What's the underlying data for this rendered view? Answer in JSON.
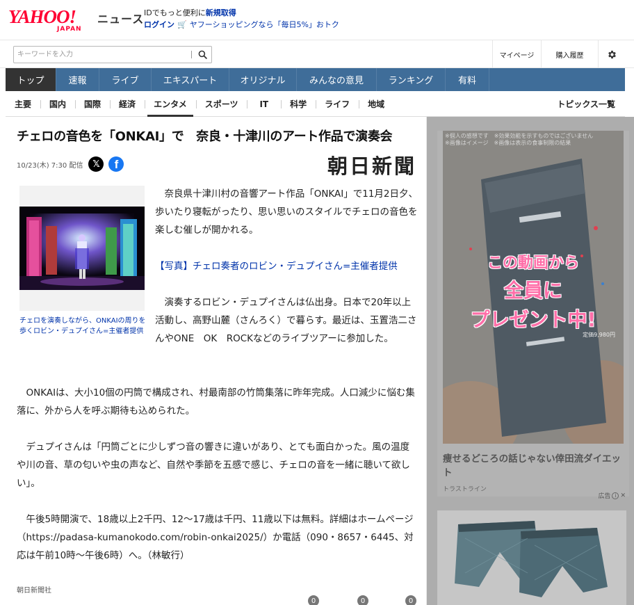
{
  "header": {
    "logo_yahoo": "YAHOO!",
    "logo_japan": "JAPAN",
    "logo_news": "ニュース",
    "promo_text": "IDでもっと便利に",
    "promo_register": "新規取得",
    "login": "ログイン",
    "shopping_promo": "ヤフーショッピングなら「毎日5%」おトク"
  },
  "search": {
    "placeholder": "キーワードを入力",
    "mypage": "マイページ",
    "purchase_history": "購入履歴"
  },
  "main_nav": [
    {
      "label": "トップ"
    },
    {
      "label": "速報"
    },
    {
      "label": "ライブ"
    },
    {
      "label": "エキスパート"
    },
    {
      "label": "オリジナル"
    },
    {
      "label": "みんなの意見"
    },
    {
      "label": "ランキング"
    },
    {
      "label": "有料"
    }
  ],
  "sub_nav": [
    {
      "label": "主要"
    },
    {
      "label": "国内"
    },
    {
      "label": "国際"
    },
    {
      "label": "経済"
    },
    {
      "label": "エンタメ"
    },
    {
      "label": "スポーツ"
    },
    {
      "label": "IT"
    },
    {
      "label": "科学"
    },
    {
      "label": "ライフ"
    },
    {
      "label": "地域"
    }
  ],
  "topics_all": "トピックス一覧",
  "article": {
    "title": "チェロの音色を「ONKAI」で　奈良・十津川のアート作品で演奏会",
    "date": "10/23(木) 7:30",
    "delivered": "配信",
    "publisher": "朝日新聞",
    "photo_caption": "チェロを演奏しながら、ONKAIの周りを歩くロビン・デュプイさん=主催者提供",
    "p1": "奈良県十津川村の音響アート作品「ONKAI」で11月2日夕、歩いたり寝転がったり、思い思いのスタイルでチェロの音色を楽しむ催しが開かれる。",
    "photo_link": "【写真】チェロ奏者のロビン・デュプイさん=主催者提供",
    "p2": "演奏するロビン・デュプイさんは仏出身。日本で20年以上活動し、高野山麓（さんろく）で暮らす。最近は、玉置浩二さんやONE　OK　ROCKなどのライブツアーに参加した。",
    "p3": "ONKAIは、大小10個の円筒で構成され、村最南部の竹筒集落に昨年完成。人口減少に悩む集落に、外から人を呼ぶ期待も込められた。",
    "p4": "デュプイさんは「円筒ごとに少しずつ音の響きに違いがあり、とても面白かった。風の温度や川の音、草の匂いや虫の声など、自然や季節を五感で感じ、チェロの音を一緒に聴いて欲しい」。",
    "p5": "午後5時開演で、18歳以上2千円、12～17歳は千円、11歳以下は無料。詳細はホームページ（https://padasa-kumanokodo.com/robin-onkai2025/）か電話（090・8657・6445、対応は午前10時～午後6時）へ。（林敏行）",
    "source": "朝日新聞社",
    "reactions": [
      "0",
      "0",
      "0"
    ]
  },
  "ads": {
    "ad1_disclaimer": "※個人の感想です　※効果効能を示すものではございません",
    "ad1_disclaimer2": "※画像はイメージ　※画像は表示の食事制限の結果",
    "ad1_line1": "この動画から",
    "ad1_line2": "全員に",
    "ad1_line3": "プレゼント中!",
    "ad1_price": "定価9,980円",
    "ad1_title": "痩せるどころの話じゃない倖田流ダイエット",
    "ad1_sponsor": "トラストライン",
    "ad_label": "広告"
  }
}
